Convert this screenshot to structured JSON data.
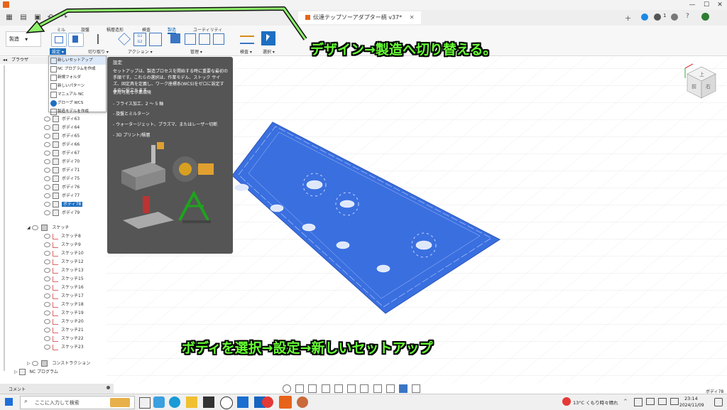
{
  "window": {
    "title": "伝達テップソーアダプター柄 v37*",
    "notif_count": "1"
  },
  "workspace": {
    "label": "製造",
    "dropdown_arrow": "▼"
  },
  "ribbon_tabs": [
    "ミル",
    "旋盤",
    "積層造形",
    "検査",
    "製造",
    "ユーティリティ"
  ],
  "ribbon_groups": {
    "setup": "設定 ▾",
    "cutting": "切り取り ▾",
    "actions": "アクション ▾",
    "manage": "管理 ▾",
    "inspect": "検査 ▾",
    "select": "選択 ▾"
  },
  "setup_dropdown": {
    "items": [
      {
        "label": "新しいセットアップ",
        "icon": "setup-icon"
      },
      {
        "label": "NC プログラムを作成",
        "icon": "nc-icon"
      },
      {
        "label": "新規フォルダ",
        "icon": "folder-icon"
      },
      {
        "label": "新しいパターン",
        "icon": "pattern-icon"
      },
      {
        "label": "マニュアル NC",
        "icon": "manual-icon"
      },
      {
        "label": "グローブ WCS",
        "icon": "wcs-icon"
      },
      {
        "label": "製造モデルを作成",
        "icon": "model-icon"
      }
    ]
  },
  "tooltip": {
    "title": "設定",
    "body": "セットアップは、製造プロセスを開始する時に重要な最初の手順です。これらの選択は、作業モデル、ストック サイズ、固定具を定義し、ワーク座標系(WCS)をゼロに設定するのに役立ちます。",
    "env_heading": "使用可能な作業環境",
    "envs": [
      "- フライス加工、2 ～ 5 軸",
      "- 旋盤とミルターン",
      "- ウォータージェット、プラズマ、またはレーザー切断",
      "- 3D プリント/積層"
    ]
  },
  "browser": {
    "header": "ブラウザ",
    "bodies": [
      "ボディ63",
      "ボディ64",
      "ボディ65",
      "ボディ66",
      "ボディ67",
      "ボディ70",
      "ボディ71",
      "ボディ75",
      "ボディ76",
      "ボディ77",
      "ボディ78",
      "ボディ79"
    ],
    "selected_body": "ボディ78",
    "sketch_folder": "スケッチ",
    "sketches": [
      "スケッチ8",
      "スケッチ9",
      "スケッチ10",
      "スケッチ12",
      "スケッチ13",
      "スケッチ15",
      "スケッチ16",
      "スケッチ17",
      "スケッチ18",
      "スケッチ19",
      "スケッチ20",
      "スケッチ21",
      "スケッチ22",
      "スケッチ23"
    ],
    "construction": "コンストラクション",
    "nc_program": "NC プログラム"
  },
  "viewcube": {
    "top": "上",
    "front": "前",
    "right": "右"
  },
  "comments_label": "コメント",
  "status_selection": "ボディ78",
  "callouts": {
    "top": "デザイン→製造へ切り替える。",
    "bottom": "ボディを選択→設定→新しいセットアップ"
  },
  "taskbar": {
    "search_placeholder": "ここに入力して検索",
    "weather": "13°C くもり時々晴れ",
    "time": "23:14",
    "date": "2024/11/09"
  },
  "colors": {
    "plate": "#3a6fe0",
    "accent": "#1d6fc1",
    "callout": "#66ff33",
    "arrow": "#4caf50"
  }
}
